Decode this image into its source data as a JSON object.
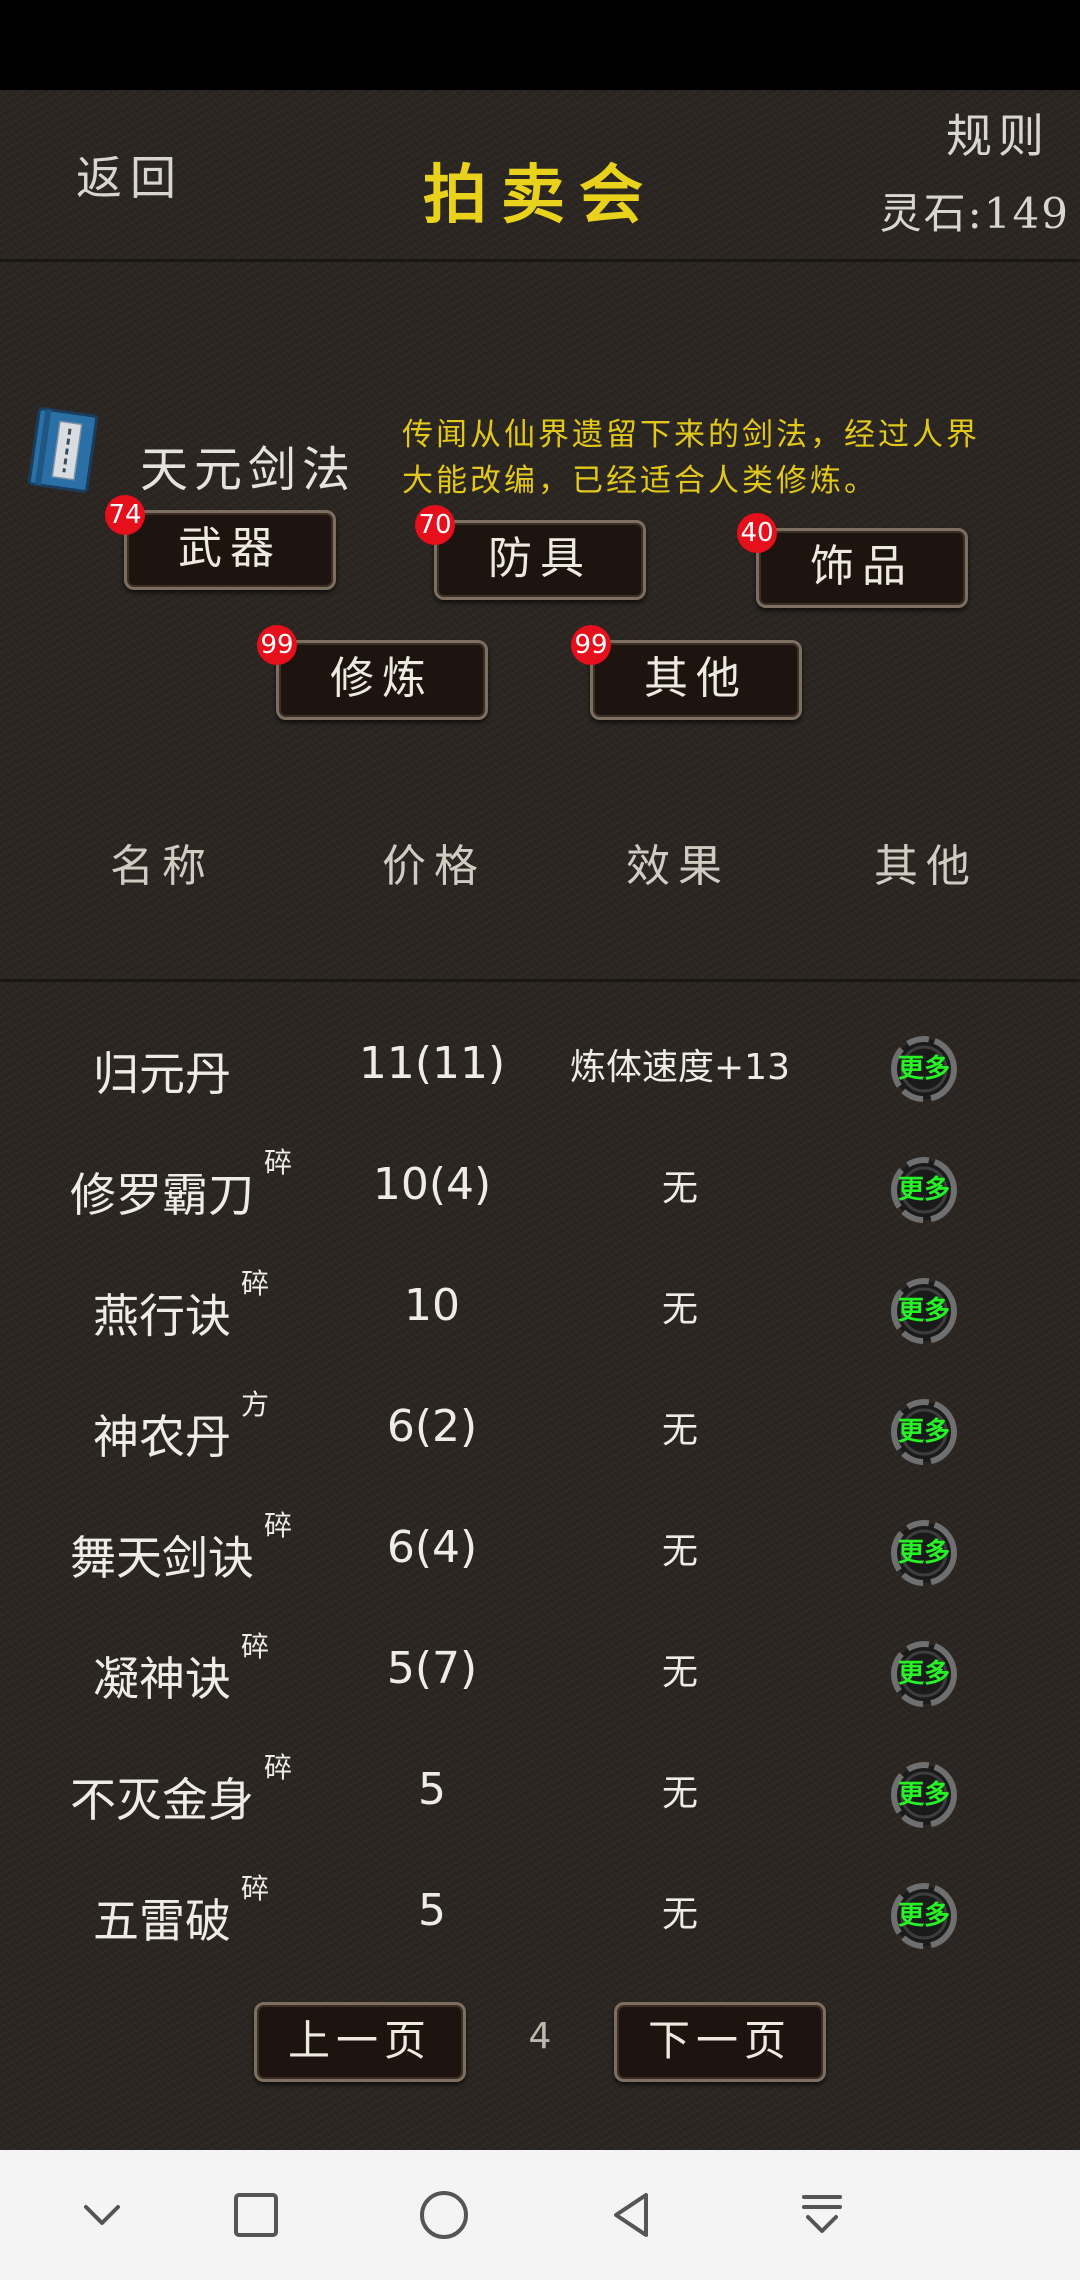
{
  "header": {
    "back_label": "返回",
    "title": "拍卖会",
    "rules_label": "规则",
    "spirit_stones": "灵石:149"
  },
  "featured_item": {
    "icon": "book-icon",
    "name": "天元剑法",
    "description": "传闻从仙界遗留下来的剑法，经过人界大能改编，已经适合人类修炼。"
  },
  "categories": [
    {
      "label": "武器",
      "count": "74"
    },
    {
      "label": "防具",
      "count": "70"
    },
    {
      "label": "饰品",
      "count": "40"
    },
    {
      "label": "修炼",
      "count": "99"
    },
    {
      "label": "其他",
      "count": "99"
    }
  ],
  "table": {
    "headers": [
      "名称",
      "价格",
      "效果",
      "其他"
    ],
    "more_label": "更多",
    "rows": [
      {
        "name": "归元丹",
        "tag": "",
        "price": "11(11)",
        "effect": "炼体速度+13"
      },
      {
        "name": "修罗霸刀",
        "tag": "碎",
        "price": "10(4)",
        "effect": "无"
      },
      {
        "name": "燕行诀",
        "tag": "碎",
        "price": "10",
        "effect": "无"
      },
      {
        "name": "神农丹",
        "tag": "方",
        "price": "6(2)",
        "effect": "无"
      },
      {
        "name": "舞天剑诀",
        "tag": "碎",
        "price": "6(4)",
        "effect": "无"
      },
      {
        "name": "凝神诀",
        "tag": "碎",
        "price": "5(7)",
        "effect": "无"
      },
      {
        "name": "不灭金身",
        "tag": "碎",
        "price": "5",
        "effect": "无"
      },
      {
        "name": "五雷破",
        "tag": "碎",
        "price": "5",
        "effect": "无"
      }
    ]
  },
  "pagination": {
    "prev_label": "上一页",
    "page": "4",
    "next_label": "下一页"
  },
  "navbar": {
    "icons": [
      "chevron-down-icon",
      "square-icon",
      "circle-icon",
      "triangle-back-icon",
      "download-tray-icon"
    ]
  }
}
